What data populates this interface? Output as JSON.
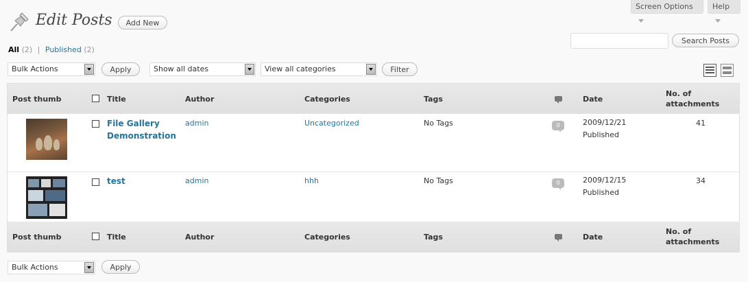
{
  "top": {
    "screen_options": "Screen Options",
    "help": "Help"
  },
  "header": {
    "title": "Edit Posts",
    "add_new": "Add New"
  },
  "filters": {
    "all_label": "All",
    "all_count": "(2)",
    "separator": "|",
    "published_label": "Published",
    "published_count": "(2)"
  },
  "search": {
    "button": "Search Posts",
    "value": ""
  },
  "toolbar": {
    "bulk_actions": "Bulk Actions",
    "apply": "Apply",
    "dates": "Show all dates",
    "categories": "View all categories",
    "filter": "Filter"
  },
  "columns": {
    "thumb": "Post thumb",
    "title": "Title",
    "author": "Author",
    "categories": "Categories",
    "tags": "Tags",
    "date": "Date",
    "attachments_1": "No. of",
    "attachments_2": "attachments"
  },
  "rows": [
    {
      "title_1": "File Gallery",
      "title_2": "Demonstration",
      "author": "admin",
      "category": "Uncategorized",
      "tags": "No Tags",
      "comments": "0",
      "date": "2009/12/21",
      "status": "Published",
      "attachments": "41"
    },
    {
      "title_1": "test",
      "author": "admin",
      "category": "hhh",
      "tags": "No Tags",
      "comments": "0",
      "date": "2009/12/15",
      "status": "Published",
      "attachments": "34"
    }
  ],
  "bottom": {
    "bulk_actions": "Bulk Actions",
    "apply": "Apply"
  },
  "icons": {
    "page": "pushpin-icon",
    "comments": "comment-bubble-icon",
    "view_list": "list-view-icon",
    "view_excerpt": "excerpt-view-icon"
  },
  "colors": {
    "link": "#21759b",
    "header_bg": "#dfdfdf",
    "page_bg": "#f9f9f9"
  }
}
